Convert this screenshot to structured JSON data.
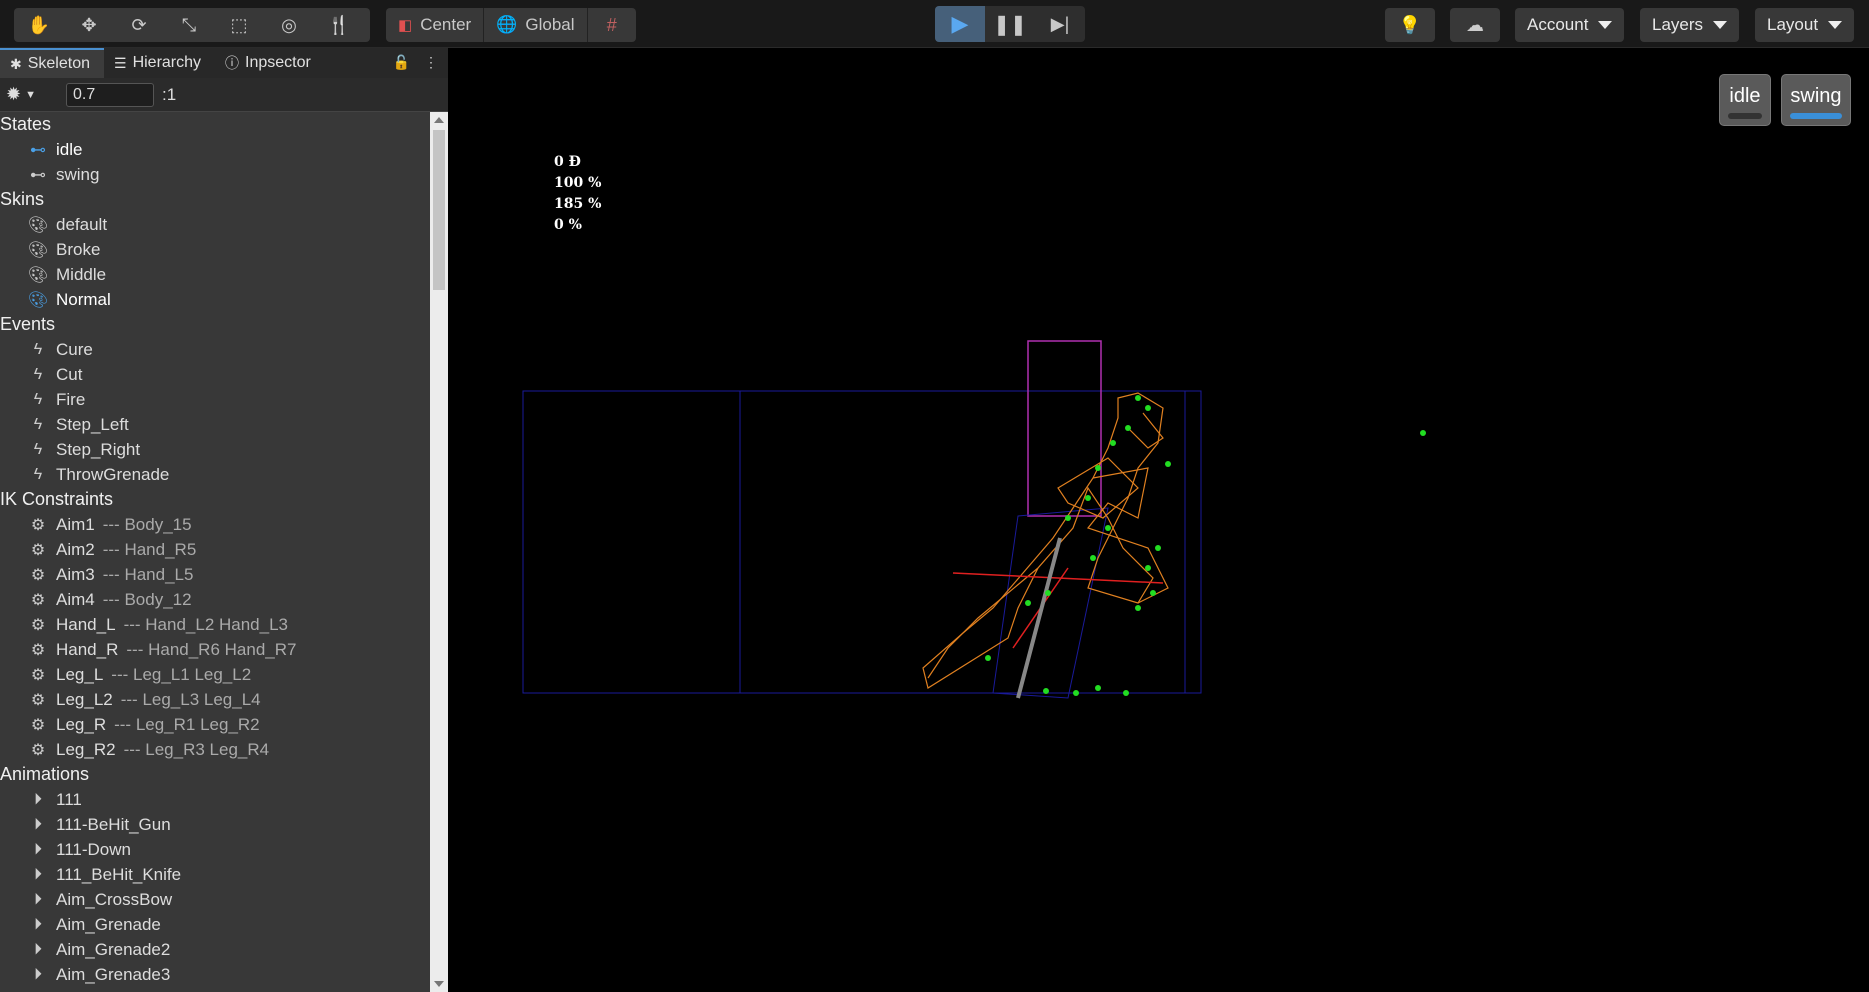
{
  "toolbar": {
    "tools": [
      "hand-icon",
      "move-icon",
      "rotate-icon",
      "scale-icon",
      "rect-icon",
      "target-icon",
      "utensils-icon"
    ],
    "center_label": "Center",
    "global_label": "Global",
    "playback": [
      "play-icon",
      "pause-icon",
      "step-icon"
    ],
    "account_label": "Account",
    "layers_label": "Layers",
    "layout_label": "Layout"
  },
  "panel": {
    "tabs": [
      "Skeleton",
      "Hierarchy",
      "Inpsector"
    ],
    "scale_value": "0.7",
    "scale_suffix": ":1"
  },
  "tree": {
    "states_title": "States",
    "states": [
      "idle",
      "swing"
    ],
    "skins_title": "Skins",
    "skins": [
      "default",
      "Broke",
      "Middle",
      "Normal"
    ],
    "events_title": "Events",
    "events": [
      "Cure",
      "Cut",
      "Fire",
      "Step_Left",
      "Step_Right",
      "ThrowGrenade"
    ],
    "ik_title": "IK Constraints",
    "ik": [
      {
        "name": "Aim1",
        "target": "--- Body_15"
      },
      {
        "name": "Aim2",
        "target": "--- Hand_R5"
      },
      {
        "name": "Aim3",
        "target": "--- Hand_L5"
      },
      {
        "name": "Aim4",
        "target": "--- Body_12"
      },
      {
        "name": "Hand_L",
        "target": "--- Hand_L2 Hand_L3"
      },
      {
        "name": "Hand_R",
        "target": "--- Hand_R6 Hand_R7"
      },
      {
        "name": "Leg_L",
        "target": "--- Leg_L1 Leg_L2"
      },
      {
        "name": "Leg_L2",
        "target": "--- Leg_L3 Leg_L4"
      },
      {
        "name": "Leg_R",
        "target": "--- Leg_R1 Leg_R2"
      },
      {
        "name": "Leg_R2",
        "target": "--- Leg_R3 Leg_R4"
      }
    ],
    "anim_title": "Animations",
    "animations": [
      "111",
      "111-BeHit_Gun",
      "111-Down",
      "111_BeHit_Knife",
      "Aim_CrossBow",
      "Aim_Grenade",
      "Aim_Grenade2",
      "Aim_Grenade3"
    ]
  },
  "viewport": {
    "stats": [
      "0 Đ",
      "100 %",
      "185 %",
      "0 %"
    ],
    "state_buttons": [
      "idle",
      "swing"
    ],
    "active_state": "swing"
  }
}
